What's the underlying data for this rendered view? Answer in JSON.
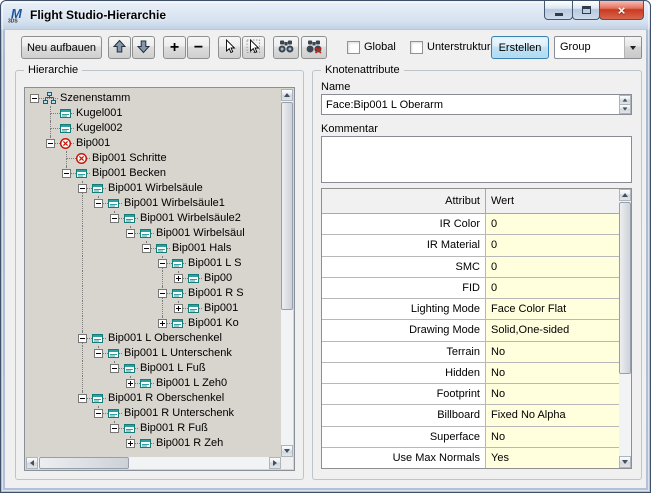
{
  "window": {
    "title": "Flight Studio-Hierarchie"
  },
  "toolbar": {
    "rebuild_label": "Neu aufbauen",
    "global_label": "Global",
    "substructure_label": "Unterstruktur",
    "create_label": "Erstellen",
    "group_value": "Group"
  },
  "icons": {
    "app": "3ds-max-m-logo",
    "minimize": "minimize-bar",
    "maximize": "maximize-box",
    "close_glyph": "×",
    "move_up": "arrow-up",
    "move_down": "arrow-down",
    "expand_all_glyph": "+",
    "collapse_all_glyph": "−",
    "select": "cursor-arrow",
    "select_branch": "cursor-arrow-dotted",
    "search": "binoculars",
    "search_cancel": "binoculars-red-x",
    "combo_arrow": "triangle-down",
    "tree_scene": "hierarchy-root",
    "tree_node": "teal-node-box",
    "tree_excluded": "red-circle-x"
  },
  "colors": {
    "value_cell_bg": "#FFFFDE",
    "tree_bg": "#D8D5CE",
    "default_button_border": "#3C7FB1",
    "close_button": "#C93A22",
    "red_icon": "#C41807",
    "teal_icon": "#157C7C"
  },
  "hierarchy": {
    "group_label": "Hierarchie",
    "items": [
      {
        "label": "Szenenstamm",
        "depth": 0,
        "expand": "minus",
        "icon": "scene"
      },
      {
        "label": "Kugel001",
        "depth": 1,
        "expand": "none",
        "icon": "node"
      },
      {
        "label": "Kugel002",
        "depth": 1,
        "expand": "none",
        "icon": "node"
      },
      {
        "label": "Bip001",
        "depth": 1,
        "expand": "minus",
        "icon": "redx"
      },
      {
        "label": "Bip001 Schritte",
        "depth": 2,
        "expand": "none",
        "icon": "redx"
      },
      {
        "label": "Bip001 Becken",
        "depth": 2,
        "expand": "minus",
        "icon": "node"
      },
      {
        "label": "Bip001 Wirbelsäule",
        "depth": 3,
        "expand": "minus",
        "icon": "node"
      },
      {
        "label": "Bip001 Wirbelsäule1",
        "depth": 4,
        "expand": "minus",
        "icon": "node"
      },
      {
        "label": "Bip001 Wirbelsäule2",
        "depth": 5,
        "expand": "minus",
        "icon": "node"
      },
      {
        "label": "Bip001 Wirbelsäul",
        "depth": 6,
        "expand": "minus",
        "icon": "node"
      },
      {
        "label": "Bip001 Hals",
        "depth": 7,
        "expand": "minus",
        "icon": "node"
      },
      {
        "label": "Bip001 L S",
        "depth": 8,
        "expand": "minus",
        "icon": "node"
      },
      {
        "label": "Bip00",
        "depth": 9,
        "expand": "plus",
        "icon": "node"
      },
      {
        "label": "Bip001 R S",
        "depth": 8,
        "expand": "minus",
        "icon": "node"
      },
      {
        "label": "Bip001",
        "depth": 9,
        "expand": "plus",
        "icon": "node"
      },
      {
        "label": "Bip001 Ko",
        "depth": 8,
        "expand": "plus",
        "icon": "node"
      },
      {
        "label": "Bip001 L Oberschenkel",
        "depth": 3,
        "expand": "minus",
        "icon": "node"
      },
      {
        "label": "Bip001 L Unterschenk",
        "depth": 4,
        "expand": "minus",
        "icon": "node"
      },
      {
        "label": "Bip001 L Fuß",
        "depth": 5,
        "expand": "minus",
        "icon": "node"
      },
      {
        "label": "Bip001 L Zeh0",
        "depth": 6,
        "expand": "plus",
        "icon": "node"
      },
      {
        "label": "Bip001 R Oberschenkel",
        "depth": 3,
        "expand": "minus",
        "icon": "node"
      },
      {
        "label": "Bip001 R Unterschenk",
        "depth": 4,
        "expand": "minus",
        "icon": "node"
      },
      {
        "label": "Bip001 R Fuß",
        "depth": 5,
        "expand": "minus",
        "icon": "node"
      },
      {
        "label": "Bip001 R Zeh",
        "depth": 6,
        "expand": "plus",
        "icon": "node"
      }
    ]
  },
  "attributes": {
    "group_label": "Knotenattribute",
    "name_label": "Name",
    "name_value": "Face:Bip001 L Oberarm",
    "comment_label": "Kommentar",
    "comment_value": "",
    "table": {
      "headers": [
        "Attribut",
        "Wert"
      ],
      "rows": [
        [
          "IR Color",
          "0"
        ],
        [
          "IR Material",
          "0"
        ],
        [
          "SMC",
          "0"
        ],
        [
          "FID",
          "0"
        ],
        [
          "Lighting Mode",
          "Face Color Flat"
        ],
        [
          "Drawing Mode",
          "Solid,One-sided"
        ],
        [
          "Terrain",
          "No"
        ],
        [
          "Hidden",
          "No"
        ],
        [
          "Footprint",
          "No"
        ],
        [
          "Billboard",
          "Fixed No Alpha"
        ],
        [
          "Superface",
          "No"
        ],
        [
          "Use Max Normals",
          "Yes"
        ]
      ]
    }
  }
}
